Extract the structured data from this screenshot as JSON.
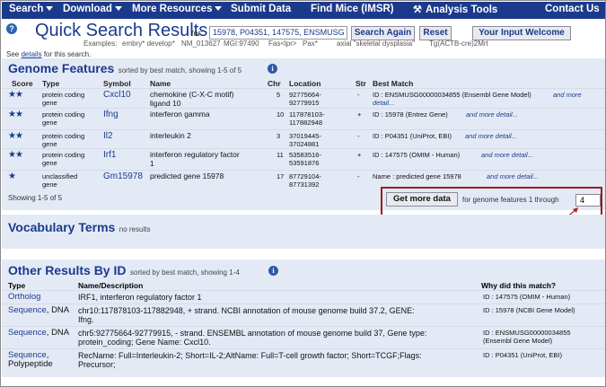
{
  "nav": {
    "search": "Search",
    "download": "Download",
    "more": "More Resources",
    "submit": "Submit Data",
    "findmice": "Find Mice (IMSR)",
    "analysis": "Analysis Tools",
    "contact": "Contact Us"
  },
  "header": {
    "title": "Quick Search Results",
    "for_label": "for:",
    "query": "15978, P04351, 147575, ENSMUSG",
    "search_again": "Search Again",
    "reset": "Reset",
    "welcome": "Your Input Welcome",
    "examples_label": "Examples:",
    "ex1": "embry* develop*",
    "ex2": "NM_013627",
    "ex3": "MGI:97490",
    "ex4": "Fas<lpr>",
    "ex5": "Pax*",
    "ex6": "axial \"skeletal dysplasia\"",
    "ex7": "Tg(ACTB-cre)2Mrt",
    "see": "See",
    "details": "details",
    "for_search": "for this search."
  },
  "genome": {
    "title": "Genome Features",
    "sub": "sorted by best match, showing 1-5 of 5",
    "cols": [
      "Score",
      "Type",
      "Symbol",
      "Name",
      "Chr",
      "Location",
      "Str",
      "Best Match"
    ],
    "rows": [
      {
        "score": "★★",
        "type1": "protein coding",
        "type2": "gene",
        "symbol": "Cxcl10",
        "name1": "chemokine (C-X-C motif)",
        "name2": "ligand 10",
        "chr": "5",
        "loc1": "92775664-",
        "loc2": "92779915",
        "str": "-",
        "match": "ID : ENSMUSG00000034855 (Ensembl Gene Model)",
        "more": "and more",
        "more2": "detail..."
      },
      {
        "score": "★★",
        "type1": "protein coding",
        "type2": "gene",
        "symbol": "Ifng",
        "name1": "interferon gamma",
        "name2": "",
        "chr": "10",
        "loc1": "117878103-",
        "loc2": "117882948",
        "str": "+",
        "match": "ID : 15978 (Entrez Gene)",
        "more": "and more detail...",
        "more2": ""
      },
      {
        "score": "★★",
        "type1": "protein coding",
        "type2": "gene",
        "symbol": "Il2",
        "name1": "interleukin 2",
        "name2": "",
        "chr": "3",
        "loc1": "37019445-",
        "loc2": "37024881",
        "str": "-",
        "match": "ID : P04351 (UniProt, EBI)",
        "more": "and more detail...",
        "more2": ""
      },
      {
        "score": "★★",
        "type1": "protein coding",
        "type2": "gene",
        "symbol": "Irf1",
        "name1": "interferon regulatory factor",
        "name2": "1",
        "chr": "11",
        "loc1": "53583516-",
        "loc2": "53591876",
        "str": "+",
        "match": "ID : 147575 (OMIM - Human)",
        "more": "and more detail...",
        "more2": ""
      },
      {
        "score": "★",
        "type1": "unclassified",
        "type2": "gene",
        "symbol": "Gm15978",
        "name1": "predicted gene 15978",
        "name2": "",
        "chr": "17",
        "loc1": "87729104-",
        "loc2": "87731392",
        "str": "-",
        "match": "Name : predicted gene 15978",
        "more": "and more detail...",
        "more2": ""
      }
    ],
    "showing": "Showing 1-5 of 5",
    "getmore": "Get more data",
    "through": "for genome features 1 through",
    "through_value": "4"
  },
  "vocab": {
    "title": "Vocabulary Terms",
    "sub": "no results"
  },
  "other": {
    "title": "Other Results By ID",
    "sub": "sorted by best match, showing 1-4",
    "cols": [
      "Type",
      "Name/Description",
      "Why did this match?"
    ],
    "rows": [
      {
        "type1": "Ortholog",
        "type1b": "",
        "type2": "",
        "desc1": "IRF1, interferon regulatory factor 1",
        "desc2": "",
        "why1": "ID : 147575 (OMIM - Human)",
        "why2": ""
      },
      {
        "type1": "Sequence",
        "type1b": ", DNA",
        "type2": "",
        "desc1": "chr10:117878103-117882948, + strand. NCBI annotation of mouse genome build 37.2, GENE:",
        "desc2": "Ifng.",
        "why1": "ID : 15978 (NCBI Gene Model)",
        "why2": ""
      },
      {
        "type1": "Sequence",
        "type1b": ", DNA",
        "type2": "",
        "desc1": "chr5:92775664-92779915, - strand. ENSEMBL annotation of mouse genome build 37, Gene type:",
        "desc2": "protein_coding; Gene Name: Cxcl10.",
        "why1": "ID : ENSMUSG00000034855",
        "why2": "(Ensembl Gene Model)"
      },
      {
        "type1": "Sequence",
        "type1b": ",",
        "type2": "Polypeptide",
        "desc1": "RecName: Full=Interleukin-2; Short=IL-2;AltName: Full=T-cell growth factor; Short=TCGF;Flags:",
        "desc2": "Precursor;",
        "why1": "ID : P04351 (UniProt, EBI)",
        "why2": ""
      }
    ]
  }
}
